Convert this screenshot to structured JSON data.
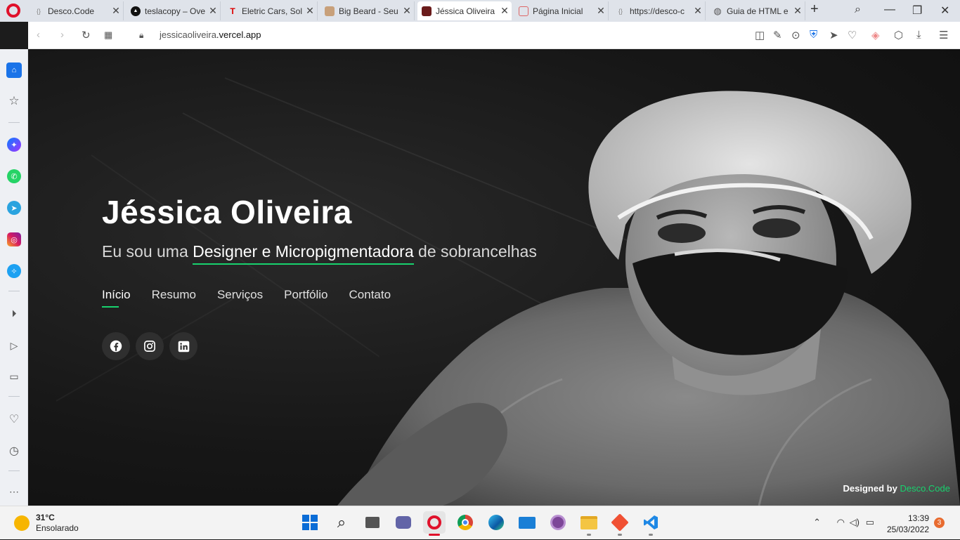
{
  "browser": {
    "tabs": [
      {
        "title": "Desco.Code",
        "icon": "code-favicon"
      },
      {
        "title": "teslacopy – Ove",
        "icon": "vercel-favicon"
      },
      {
        "title": "Eletric Cars, Sol",
        "icon": "tesla-favicon"
      },
      {
        "title": "Big Beard - Seu",
        "icon": "barber-favicon"
      },
      {
        "title": "Jéssica Oliveira",
        "icon": "site-favicon"
      },
      {
        "title": "Página Inicial",
        "icon": "page-favicon"
      },
      {
        "title": "https://desco-c",
        "icon": "code-favicon"
      },
      {
        "title": "Guia de HTML e",
        "icon": "globe-favicon"
      }
    ],
    "active_tab": 4,
    "url_prefix": "jessicaoliveira",
    "url_domain": ".vercel.app"
  },
  "hero": {
    "name": "Jéssica Oliveira",
    "subtitle_pre": "Eu sou uma ",
    "subtitle_role1": "Designer",
    "subtitle_and": " e ",
    "subtitle_role2": "Micropigmentadora",
    "subtitle_post": " de sobrancelhas",
    "nav": [
      "Início",
      "Resumo",
      "Serviços",
      "Portfólio",
      "Contato"
    ],
    "active_nav": 0,
    "credits_label": "Designed by ",
    "credits_link": "Desco.Code"
  },
  "taskbar": {
    "temp": "31°C",
    "weather": "Ensolarado",
    "time": "13:39",
    "date": "25/03/2022",
    "notifications": "3"
  },
  "colors": {
    "accent": "#18d26e",
    "opera": "#e0112b"
  }
}
